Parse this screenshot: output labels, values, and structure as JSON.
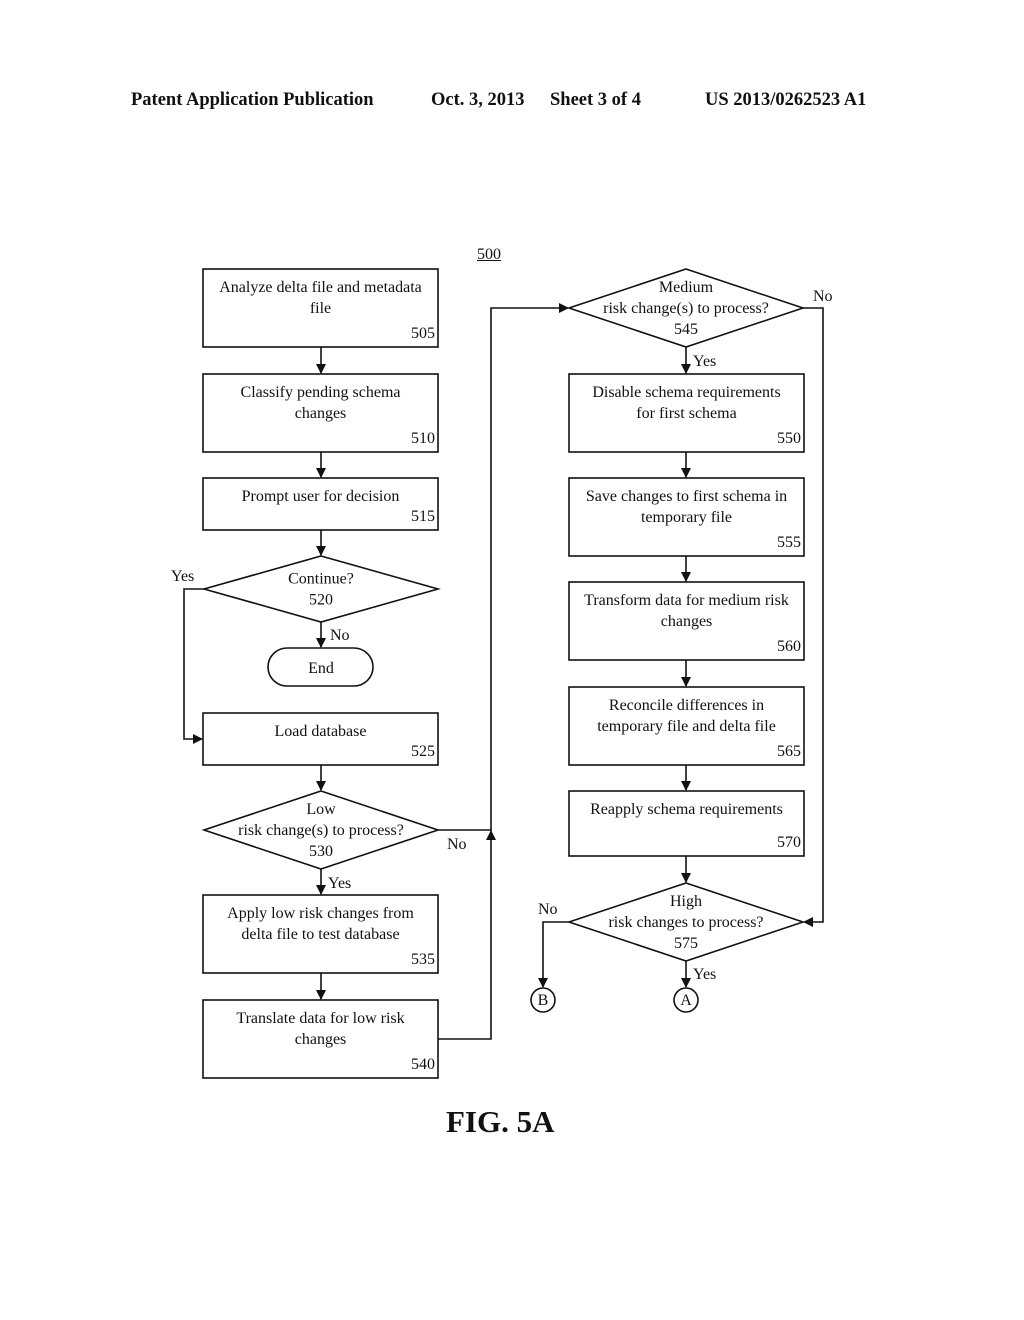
{
  "header": {
    "publication": "Patent Application Publication",
    "date": "Oct. 3, 2013",
    "sheet": "Sheet 3 of 4",
    "pub_number": "US 2013/0262523 A1"
  },
  "figure": {
    "ref": "500",
    "caption": "FIG. 5A"
  },
  "steps": {
    "s505": {
      "lines": [
        "Analyze delta file and metadata",
        "file"
      ],
      "num": "505"
    },
    "s510": {
      "lines": [
        "Classify pending schema",
        "changes"
      ],
      "num": "510"
    },
    "s515": {
      "lines": [
        "Prompt user for decision"
      ],
      "num": "515"
    },
    "d520": {
      "lines": [
        "Continue?"
      ],
      "num": "520"
    },
    "end": {
      "label": "End"
    },
    "s525": {
      "lines": [
        "Load database"
      ],
      "num": "525"
    },
    "d530": {
      "lines": [
        "Low",
        "risk change(s) to process?"
      ],
      "num": "530"
    },
    "s535": {
      "lines": [
        "Apply low risk changes from",
        "delta file to test database"
      ],
      "num": "535"
    },
    "s540": {
      "lines": [
        "Translate data for low risk",
        "changes"
      ],
      "num": "540"
    },
    "d545": {
      "lines": [
        "Medium",
        "risk change(s) to process?"
      ],
      "num": "545"
    },
    "s550": {
      "lines": [
        "Disable schema requirements",
        "for first schema"
      ],
      "num": "550"
    },
    "s555": {
      "lines": [
        "Save changes to first schema in",
        "temporary file"
      ],
      "num": "555"
    },
    "s560": {
      "lines": [
        "Transform data for medium risk",
        "changes"
      ],
      "num": "560"
    },
    "s565": {
      "lines": [
        "Reconcile differences in",
        "temporary file and delta file"
      ],
      "num": "565"
    },
    "s570": {
      "lines": [
        "Reapply schema requirements"
      ],
      "num": "570"
    },
    "d575": {
      "lines": [
        "High",
        "risk changes to process?"
      ],
      "num": "575"
    }
  },
  "connectors": {
    "A": "A",
    "B": "B"
  },
  "edge_labels": {
    "yes": "Yes",
    "no": "No"
  }
}
